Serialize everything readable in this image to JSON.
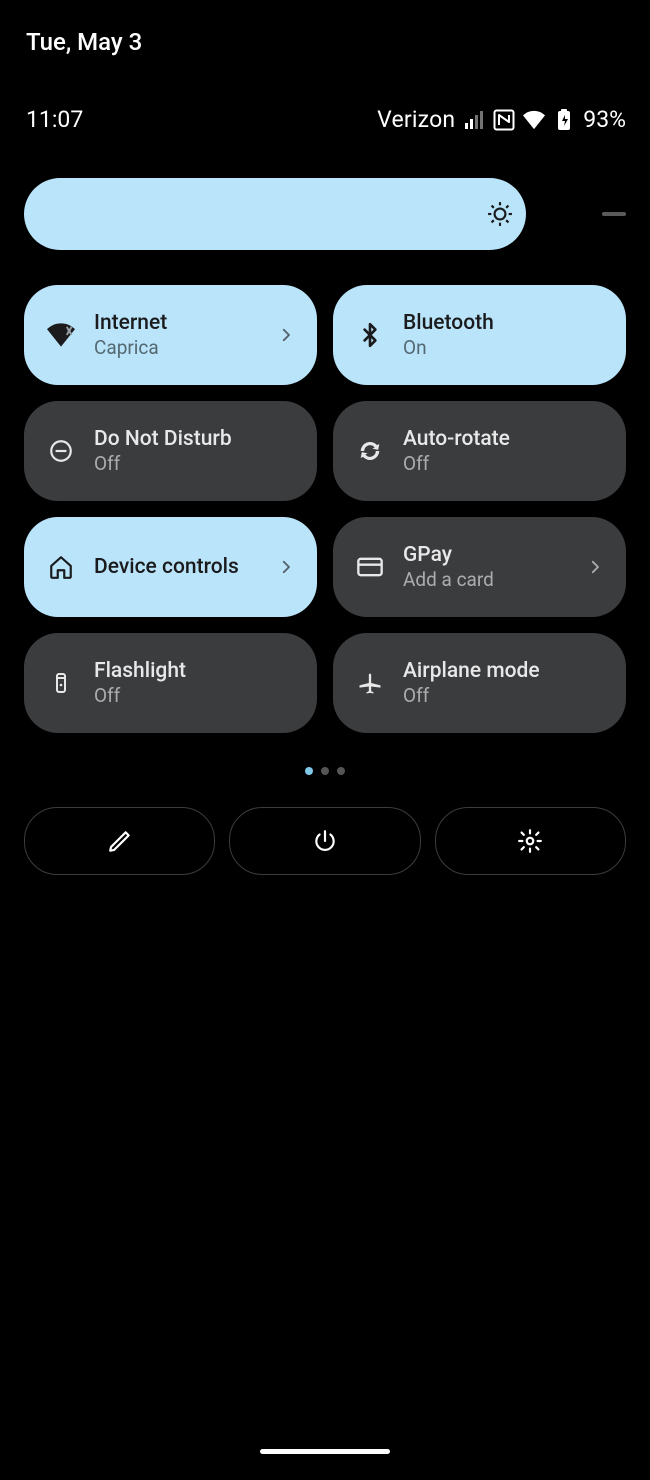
{
  "date": "Tue, May 3",
  "status": {
    "time": "11:07",
    "carrier": "Verizon",
    "battery": "93%"
  },
  "brightness": {
    "percent": 88
  },
  "tiles": [
    {
      "title": "Internet",
      "sub": "Caprica",
      "state": "on",
      "icon": "wifi",
      "chevron": true
    },
    {
      "title": "Bluetooth",
      "sub": "On",
      "state": "on",
      "icon": "bluetooth",
      "chevron": false
    },
    {
      "title": "Do Not Disturb",
      "sub": "Off",
      "state": "off",
      "icon": "dnd",
      "chevron": false
    },
    {
      "title": "Auto-rotate",
      "sub": "Off",
      "state": "off",
      "icon": "rotate",
      "chevron": false
    },
    {
      "title": "Device controls",
      "sub": "",
      "state": "on",
      "icon": "home",
      "chevron": true
    },
    {
      "title": "GPay",
      "sub": "Add a card",
      "state": "off",
      "icon": "card",
      "chevron": true
    },
    {
      "title": "Flashlight",
      "sub": "Off",
      "state": "off",
      "icon": "flash",
      "chevron": false
    },
    {
      "title": "Airplane mode",
      "sub": "Off",
      "state": "off",
      "icon": "airplane",
      "chevron": false
    }
  ],
  "page_indicator": {
    "count": 3,
    "active": 0
  },
  "bottom_buttons": [
    "edit",
    "power",
    "settings"
  ]
}
